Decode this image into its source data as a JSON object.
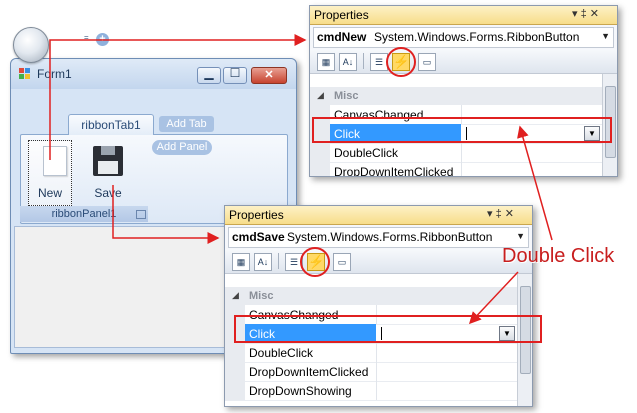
{
  "form": {
    "title": "Form1",
    "minimize_glyph": "▁",
    "maximize_glyph": "☐",
    "close_glyph": "✕",
    "qat_dropdown_glyph": "=",
    "qat_add_glyph": "+",
    "tab_label": "ribbonTab1",
    "add_tab_label": "Add Tab",
    "add_panel_label": "Add Panel",
    "button_new_label": "New",
    "button_save_label": "Save",
    "panel_label": "ribbonPanel1"
  },
  "properties_top": {
    "title": "Properties",
    "pin_glyph": "▾ ‡ ✕",
    "object_name": "cmdNew",
    "object_type": "System.Windows.Forms.RibbonButton",
    "category": "Misc",
    "rows": [
      "CanvasChanged",
      "Click",
      "DoubleClick",
      "DropDownItemClicked"
    ],
    "selected_row": "Click"
  },
  "properties_bottom": {
    "title": "Properties",
    "pin_glyph": "▾ ‡ ✕",
    "object_name": "cmdSave",
    "object_type": "System.Windows.Forms.RibbonButton",
    "category": "Misc",
    "rows": [
      "CanvasChanged",
      "Click",
      "DoubleClick",
      "DropDownItemClicked",
      "DropDownShowing"
    ],
    "selected_row": "Click"
  },
  "toolbar_glyphs": {
    "categorized": "▦",
    "alphabetical": "A↓",
    "properties": "☰",
    "events": "⚡",
    "pages": "▭"
  },
  "callout": {
    "text": "Double Click"
  },
  "colors": {
    "annotation_red": "#e02020",
    "selection_blue": "#3399ff"
  }
}
